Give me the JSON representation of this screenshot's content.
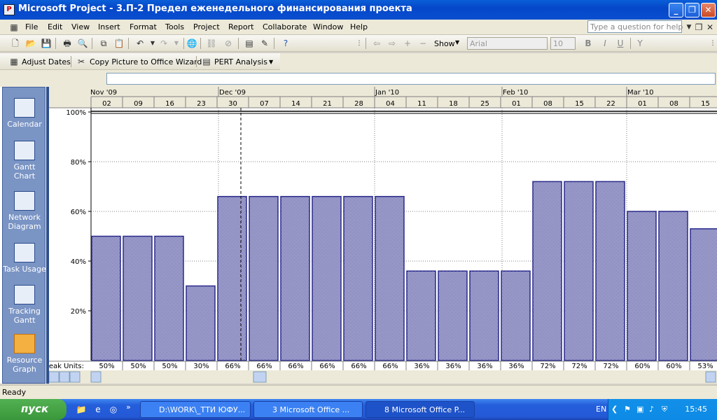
{
  "window": {
    "title": "Microsoft Project - 3.П-2 Предел еженедельного финансирования проекта"
  },
  "menu": {
    "items": [
      "File",
      "Edit",
      "View",
      "Insert",
      "Format",
      "Tools",
      "Project",
      "Report",
      "Collaborate",
      "Window",
      "Help"
    ],
    "help_placeholder": "Type a question for help"
  },
  "toolbar": {
    "show_label": "Show",
    "font_value": "Arial",
    "size_value": "10",
    "bold": "B",
    "italic": "I",
    "underline": "U"
  },
  "toolbar2": {
    "adjust_dates": "Adjust Dates",
    "copy_picture": "Copy Picture to Office Wizard",
    "pert": "PERT Analysis"
  },
  "viewbar": {
    "items": [
      "Calendar",
      "Gantt\nChart",
      "Network\nDiagram",
      "Task Usage",
      "Tracking\nGantt",
      "Resource\nGraph"
    ]
  },
  "chart_data": {
    "type": "bar",
    "months": [
      "Nov '09",
      "Dec '09",
      "Jan '10",
      "Feb '10",
      "Mar '10"
    ],
    "categories": [
      "02",
      "09",
      "16",
      "23",
      "30",
      "07",
      "14",
      "21",
      "28",
      "04",
      "11",
      "18",
      "25",
      "01",
      "08",
      "15",
      "22",
      "01",
      "08",
      "15"
    ],
    "values": [
      50,
      50,
      50,
      30,
      66,
      66,
      66,
      66,
      66,
      66,
      36,
      36,
      36,
      36,
      72,
      72,
      72,
      60,
      60,
      53
    ],
    "value_labels": [
      "50%",
      "50%",
      "50%",
      "30%",
      "66%",
      "66%",
      "66%",
      "66%",
      "66%",
      "66%",
      "36%",
      "36%",
      "36%",
      "36%",
      "72%",
      "72%",
      "72%",
      "60%",
      "60%",
      "53%"
    ],
    "ylim": [
      0,
      100
    ],
    "yticks": [
      "100%",
      "80%",
      "60%",
      "40%",
      "20%"
    ],
    "ytick_values": [
      100,
      80,
      60,
      40,
      20
    ],
    "row_label": "Peak Units:",
    "bar_color": "#2a2a8c"
  },
  "status": {
    "text": "Ready"
  },
  "taskbar": {
    "start": "пуск",
    "tasks": [
      "D:\\WORK\\_ТТИ ЮФУ...",
      "3 Microsoft Office ...",
      "8 Microsoft Office P..."
    ],
    "lang": "EN",
    "clock": "15:45"
  }
}
